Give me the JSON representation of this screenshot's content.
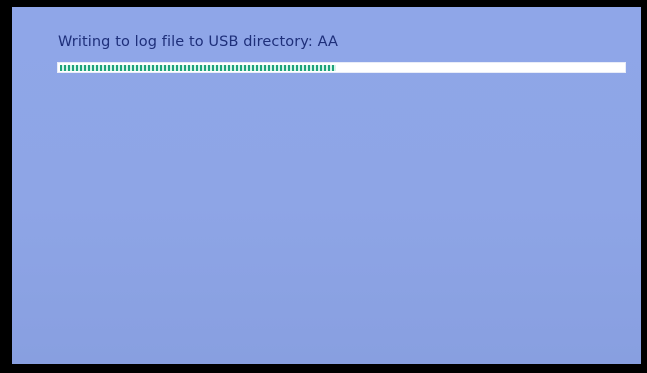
{
  "status": {
    "message": "Writing to log file to USB directory: AA"
  },
  "progress": {
    "fraction": 0.49,
    "fill_color": "#1fa37a",
    "track_color": "#ffffff"
  },
  "colors": {
    "background": "#8fa6e8",
    "text": "#1e2f7a"
  }
}
